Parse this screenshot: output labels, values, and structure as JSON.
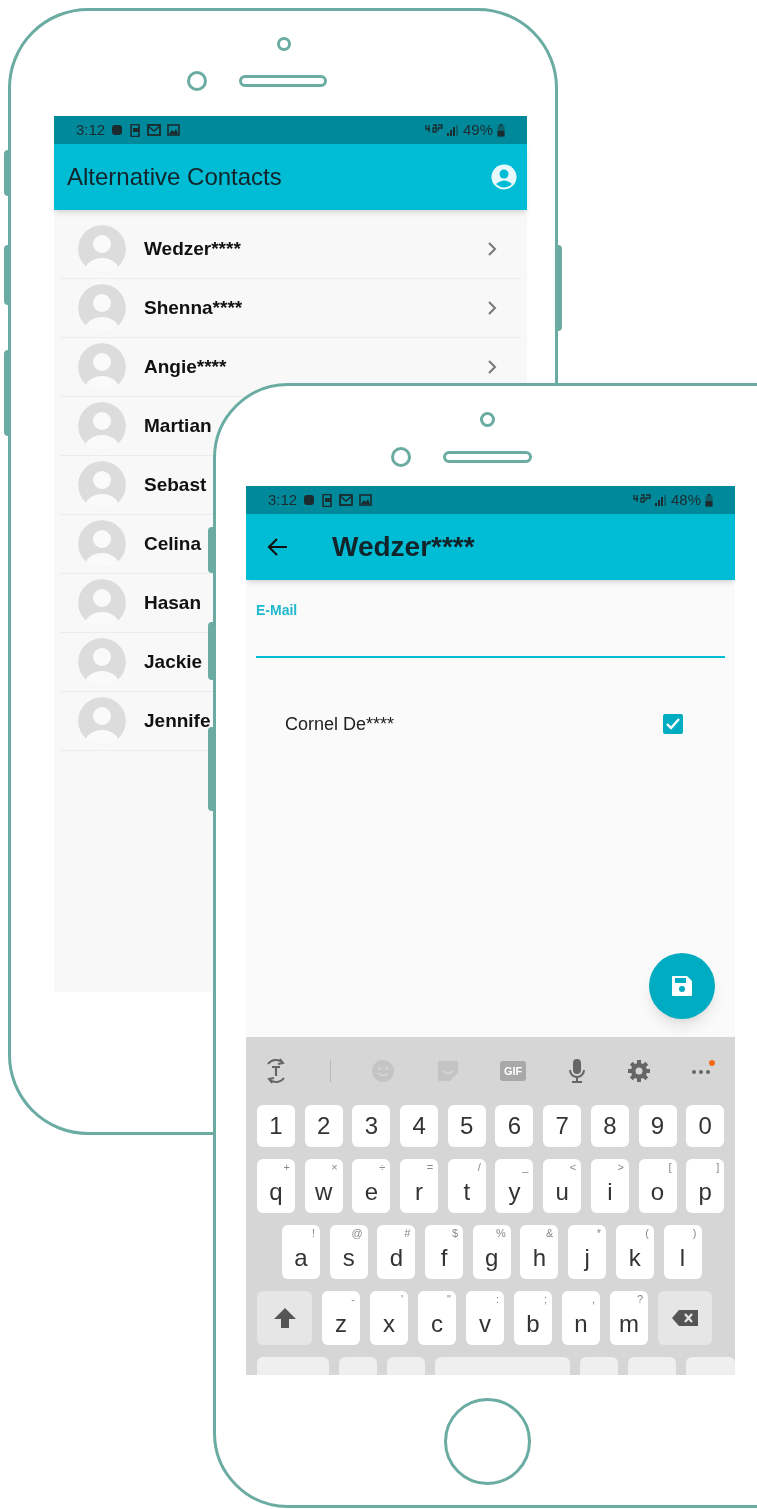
{
  "back_phone": {
    "status_bar": {
      "time": "3:12",
      "battery": "49%"
    },
    "app_bar": {
      "title": "Alternative Contacts"
    },
    "contacts": [
      {
        "name": "Wedzer****"
      },
      {
        "name": "Shenna****"
      },
      {
        "name": "Angie****"
      },
      {
        "name": "Martian"
      },
      {
        "name": "Sebast"
      },
      {
        "name": "Celina"
      },
      {
        "name": "Hasan"
      },
      {
        "name": "Jackie"
      },
      {
        "name": "Jennife"
      }
    ]
  },
  "front_phone": {
    "status_bar": {
      "time": "3:12",
      "battery": "48%"
    },
    "app_bar": {
      "title": "Wedzer****"
    },
    "email_field": {
      "label": "E-Mail"
    },
    "options": [
      {
        "label": "Cornel De****",
        "checked": true
      }
    ],
    "keyboard": {
      "toolbar": [
        {
          "kind": "translate",
          "disabled": false
        },
        {
          "kind": "emoji",
          "disabled": true
        },
        {
          "kind": "sticker",
          "disabled": true
        },
        {
          "kind": "gif",
          "label": "GIF",
          "disabled": true
        },
        {
          "kind": "mic",
          "disabled": false
        },
        {
          "kind": "settings",
          "disabled": false
        },
        {
          "kind": "more",
          "disabled": false,
          "badge": true
        }
      ],
      "rows": [
        [
          {
            "label": "1"
          },
          {
            "label": "2"
          },
          {
            "label": "3"
          },
          {
            "label": "4"
          },
          {
            "label": "5"
          },
          {
            "label": "6"
          },
          {
            "label": "7"
          },
          {
            "label": "8"
          },
          {
            "label": "9"
          },
          {
            "label": "0"
          }
        ],
        [
          {
            "label": "q",
            "hint": "+"
          },
          {
            "label": "w",
            "hint": "×"
          },
          {
            "label": "e",
            "hint": "÷"
          },
          {
            "label": "r",
            "hint": "="
          },
          {
            "label": "t",
            "hint": "/"
          },
          {
            "label": "y",
            "hint": "_"
          },
          {
            "label": "u",
            "hint": "<"
          },
          {
            "label": "i",
            "hint": ">"
          },
          {
            "label": "o",
            "hint": "["
          },
          {
            "label": "p",
            "hint": "]"
          }
        ],
        [
          {
            "label": "a",
            "hint": "!"
          },
          {
            "label": "s",
            "hint": "@"
          },
          {
            "label": "d",
            "hint": "#"
          },
          {
            "label": "f",
            "hint": "$"
          },
          {
            "label": "g",
            "hint": "%"
          },
          {
            "label": "h",
            "hint": "&"
          },
          {
            "label": "j",
            "hint": "*"
          },
          {
            "label": "k",
            "hint": "("
          },
          {
            "label": "l",
            "hint": ")"
          }
        ],
        [
          {
            "kind": "shift"
          },
          {
            "label": "z",
            "hint": "-"
          },
          {
            "label": "x",
            "hint": "'"
          },
          {
            "label": "c",
            "hint": "\""
          },
          {
            "label": "v",
            "hint": ":"
          },
          {
            "label": "b",
            "hint": ";"
          },
          {
            "label": "n",
            "hint": ","
          },
          {
            "label": "m",
            "hint": "?"
          },
          {
            "kind": "backspace"
          }
        ]
      ]
    }
  }
}
